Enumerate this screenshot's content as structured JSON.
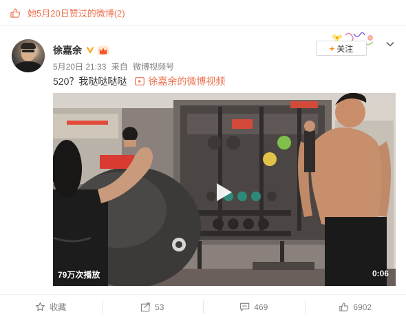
{
  "liked_bar": {
    "text": "她5月20日赞过的微博(2)",
    "icon": "thumbs-up-icon"
  },
  "post": {
    "author": {
      "name": "徐嘉余",
      "verified_icon": "verified-v-icon",
      "member_icon": "crown-icon"
    },
    "meta": {
      "date": "5月20日 21:33",
      "source_prefix": "来自",
      "source": "微博视频号"
    },
    "follow_label": "关注",
    "text": "520？我哒哒哒哒",
    "video_link": "徐嘉余的微博视频",
    "video": {
      "play_count": "79万次播放",
      "duration": "0:06"
    }
  },
  "actions": {
    "favorite": {
      "label": "收藏",
      "icon": "star-icon"
    },
    "repost": {
      "count": "53",
      "icon": "repost-icon"
    },
    "comment": {
      "count": "469",
      "icon": "comment-icon"
    },
    "like": {
      "count": "6902",
      "icon": "thumbs-up-icon"
    }
  },
  "colors": {
    "accent": "#eb7350",
    "follow_plus": "#ff8200",
    "verified": "#ffa00a"
  }
}
